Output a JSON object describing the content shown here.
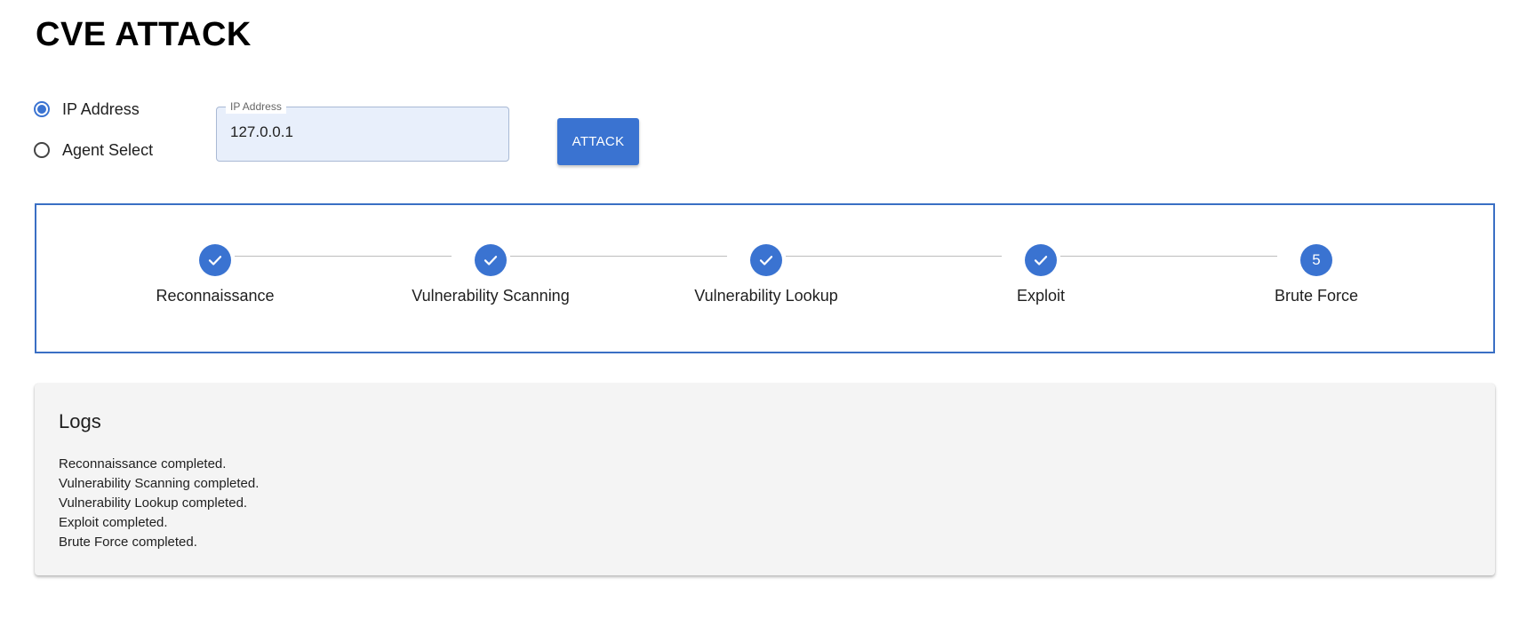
{
  "page": {
    "title": "CVE ATTACK"
  },
  "target_selector": {
    "options": [
      {
        "label": "IP Address",
        "checked": true
      },
      {
        "label": "Agent Select",
        "checked": false
      }
    ]
  },
  "ip_field": {
    "label": "IP Address",
    "value": "127.0.0.1"
  },
  "attack_button": {
    "label": "ATTACK"
  },
  "stepper": {
    "accent_color": "#3a73d1",
    "steps": [
      {
        "label": "Reconnaissance",
        "status": "completed",
        "icon": "check-icon"
      },
      {
        "label": "Vulnerability Scanning",
        "status": "completed",
        "icon": "check-icon"
      },
      {
        "label": "Vulnerability Lookup",
        "status": "completed",
        "icon": "check-icon"
      },
      {
        "label": "Exploit",
        "status": "completed",
        "icon": "check-icon"
      },
      {
        "label": "Brute Force",
        "status": "active",
        "number": "5"
      }
    ]
  },
  "logs": {
    "title": "Logs",
    "lines": [
      "Reconnaissance completed.",
      "Vulnerability Scanning completed.",
      "Vulnerability Lookup completed.",
      "Exploit completed.",
      "Brute Force completed."
    ]
  }
}
